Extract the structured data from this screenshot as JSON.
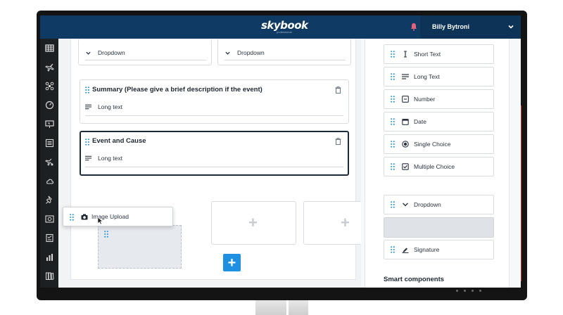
{
  "app": {
    "logo": "skybook",
    "logo_sub": "professional",
    "user_name": "Billy Bytroni"
  },
  "sidebar": {
    "icons": [
      "grid-icon",
      "plane-icon",
      "drone-icon",
      "dashboard-icon",
      "presentation-icon",
      "list-icon",
      "route-icon",
      "weather-icon",
      "pin-icon",
      "camera-icon",
      "checklist-icon",
      "chart-icon",
      "library-icon"
    ]
  },
  "form": {
    "dropdown_left": "Dropdown",
    "dropdown_right": "Dropdown",
    "summary_title": "Summary (Please give a brief description if the event)",
    "summary_field": "Long text",
    "event_title": "Event and Cause",
    "event_field": "Long text",
    "drag_item": "Image Upload",
    "add_button": "+"
  },
  "palette": {
    "items": [
      {
        "label": "Short Text",
        "icon": "short-text-icon"
      },
      {
        "label": "Long Text",
        "icon": "long-text-icon"
      },
      {
        "label": "Number",
        "icon": "number-icon"
      },
      {
        "label": "Date",
        "icon": "calendar-icon"
      },
      {
        "label": "Single Choice",
        "icon": "radio-icon"
      },
      {
        "label": "Multiple Choice",
        "icon": "checkbox-icon"
      },
      {
        "label": "Dropdown",
        "icon": "chevron-down-icon"
      },
      {
        "label": "Signature",
        "icon": "signature-icon"
      }
    ],
    "smart_components": "Smart components"
  },
  "colors": {
    "topbar": "#0f3a63",
    "sidebar": "#1d2023",
    "accent": "#1e8fe1",
    "drag_handle": "#1e8fe1"
  }
}
